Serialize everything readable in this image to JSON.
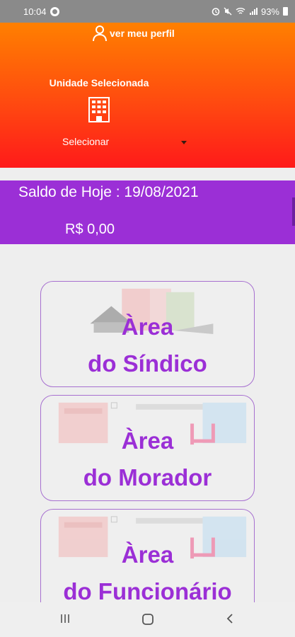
{
  "status_bar": {
    "time": "10:04",
    "battery": "93%"
  },
  "header": {
    "profile_link": "ver meu perfil",
    "unit_title": "Unidade Selecionada",
    "unit_select_value": "Selecionar",
    "gradient_top": "#ff8000",
    "gradient_bottom": "#ff1a1a"
  },
  "balance": {
    "date_text": "Saldo de Hoje : 19/08/2021",
    "amount": "R$ 0,00",
    "color": "#9b2fd6"
  },
  "areas": [
    {
      "line1": "Àrea",
      "line2": "do Síndico"
    },
    {
      "line1": "Àrea",
      "line2": "do Morador"
    },
    {
      "line1": "Àrea",
      "line2": "do Funcionário"
    }
  ],
  "icons": {
    "profile": "user-icon",
    "building": "building-icon",
    "nav_recents": "recents-icon",
    "nav_home": "home-icon",
    "nav_back": "back-icon"
  }
}
